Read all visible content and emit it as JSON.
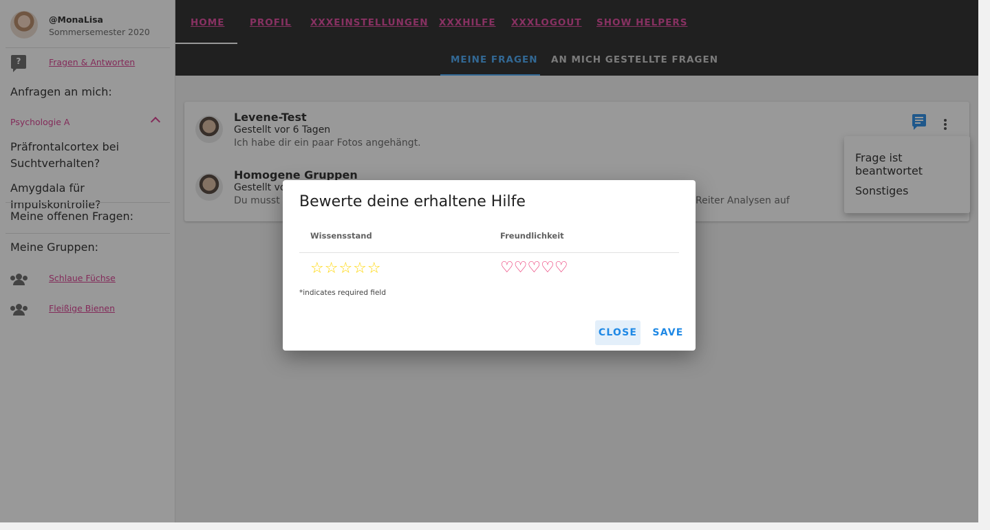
{
  "profile": {
    "name": "@MonaLisa",
    "semester": "Sommersemester 2020"
  },
  "sidebar": {
    "qa_link": "Fragen & Antworten",
    "requests_heading": "Anfragen an mich:",
    "group_name": "Psychologie A",
    "group_items": [
      "Präfrontalcortex bei Suchtverhalten?",
      "Amygdala für Impulskontrolle?"
    ],
    "open_questions_heading": "Meine offenen Fragen:",
    "my_groups_heading": "Meine Gruppen:",
    "groups": [
      "Schlaue Füchse",
      "Fleißige Bienen"
    ]
  },
  "nav": {
    "items": [
      "HOME",
      "PROFIL",
      "XXXEINSTELLUNGEN",
      "XXXHILFE",
      "XXXLOGOUT",
      "SHOW HELPERS"
    ],
    "active": "HOME"
  },
  "subtabs": {
    "items": [
      "MEINE FRAGEN",
      "AN MICH GESTELLTE FRAGEN"
    ],
    "active": "MEINE FRAGEN"
  },
  "questions": [
    {
      "title": "Levene-Test",
      "meta": "Gestellt vor 6 Tagen",
      "body": "Ich habe dir ein paar Fotos angehängt."
    },
    {
      "title": "Homogene Gruppen",
      "meta": "Gestellt vor",
      "body": "Du musst d",
      "body_tail": "Reiter Analysen auf"
    }
  ],
  "menu": {
    "items": [
      "Frage ist beantwortet",
      "Sonstiges"
    ]
  },
  "dialog": {
    "title": "Bewerte deine erhaltene Hilfe",
    "col1": "Wissensstand",
    "col2": "Freundlichkeit",
    "stars": "☆☆☆☆☆",
    "hearts": "♡♡♡♡♡",
    "required_note": "*indicates required field",
    "close_label": "CLOSE",
    "save_label": "SAVE"
  },
  "icons": [
    "question-answer-icon",
    "chevron-up-icon",
    "group-icon",
    "chat-icon",
    "more-vert-icon",
    "star-icon",
    "heart-icon"
  ],
  "colors": {
    "accent_pink": "#d6338a",
    "primary_blue": "#1e88e5",
    "star_yellow": "#ffd600",
    "heart_pink": "#e91e63",
    "topbar": "#212121"
  }
}
